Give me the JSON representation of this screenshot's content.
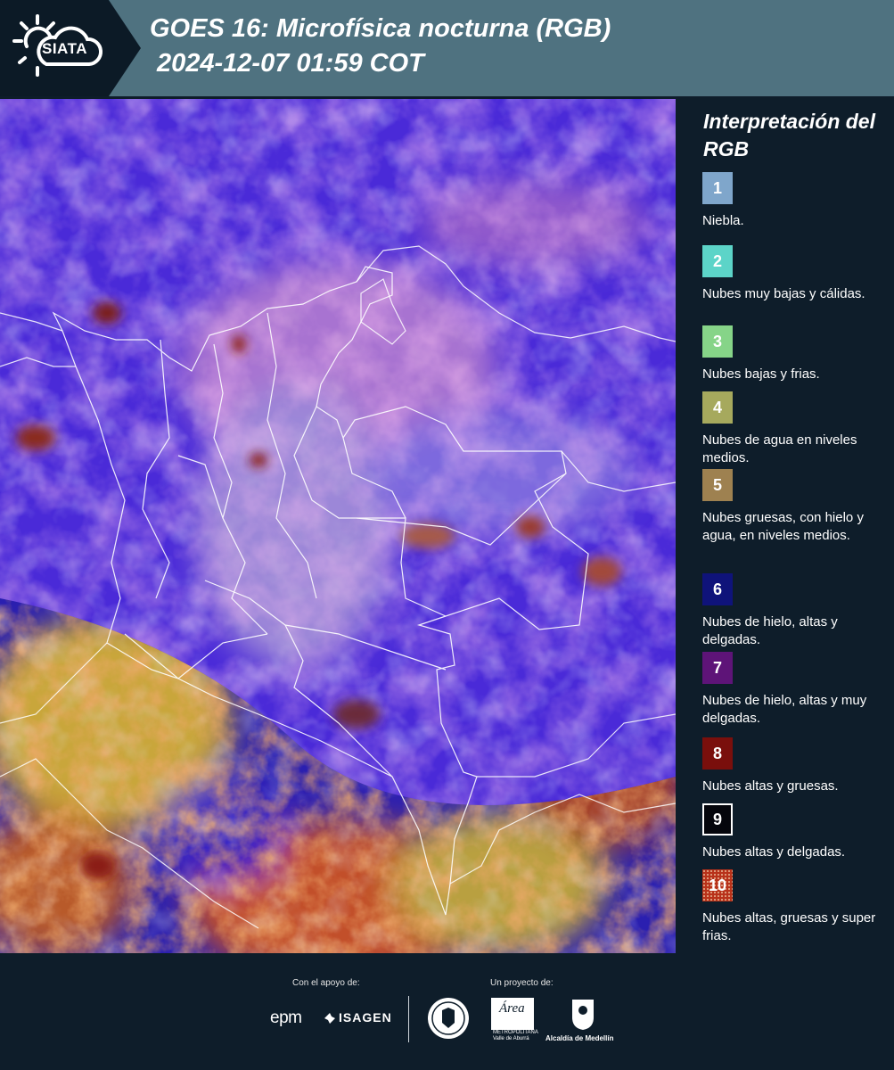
{
  "header": {
    "logo_text": "SIATA",
    "title_line1": "GOES 16: Microfísica nocturna (RGB)",
    "title_line2": "2024-12-07 01:59 COT"
  },
  "legend": {
    "title": "Interpretación del RGB",
    "items": [
      {
        "number": "1",
        "color": "#7fa6cb",
        "label": "Niebla."
      },
      {
        "number": "2",
        "color": "#5cd4c8",
        "label": "Nubes muy bajas y cálidas."
      },
      {
        "number": "3",
        "color": "#86d488",
        "label": "Nubes bajas y frias."
      },
      {
        "number": "4",
        "color": "#a6a95d",
        "label": "Nubes de agua en niveles medios."
      },
      {
        "number": "5",
        "color": "#9e8150",
        "label": "Nubes gruesas, con hielo y agua, en niveles medios."
      },
      {
        "number": "6",
        "color": "#0f137a",
        "label": "Nubes de hielo, altas y delgadas."
      },
      {
        "number": "7",
        "color": "#5e1478",
        "label": "Nubes de hielo, altas y muy delgadas."
      },
      {
        "number": "8",
        "color": "#7a0f0c",
        "label": "Nubes altas y gruesas."
      },
      {
        "number": "9",
        "color": "#05060c",
        "label": "Nubes altas y delgadas."
      },
      {
        "number": "10",
        "color": "#b8321a",
        "label": "Nubes altas, gruesas y super frias."
      }
    ]
  },
  "footer": {
    "support_caption": "Con el apoyo de:",
    "project_caption": "Un proyecto de:",
    "epm": "epm",
    "isagen": "ISAGEN",
    "area_name": "Área",
    "area_sub1": "METROPOLITANA",
    "area_sub2": "Valle de Aburrá",
    "alcaldia": "Alcaldía de Medellín"
  }
}
